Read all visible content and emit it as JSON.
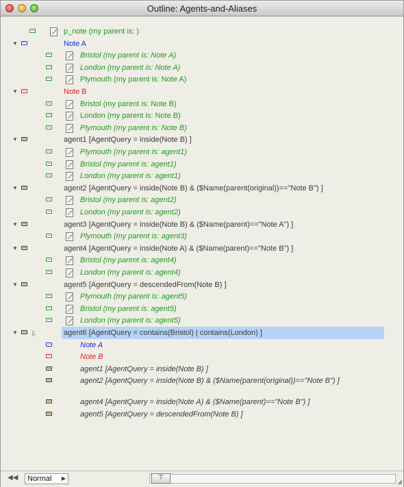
{
  "window": {
    "title": "Outline: Agents-and-Aliases"
  },
  "colors": {
    "green": "#1f9a1f",
    "blue": "#1f2bdc",
    "red": "#dc1f1f",
    "gray": "#3a3a3a",
    "selection": "#b5d3f5"
  },
  "rows": [
    {
      "indent": 0,
      "expand": false,
      "icon": "green",
      "doc": true,
      "alias": false,
      "label": "p_note  (my parent is: )",
      "color": "green",
      "italic": false
    },
    {
      "indent": 0,
      "expand": true,
      "icon": "blue",
      "doc": false,
      "alias": false,
      "label": "Note A",
      "color": "blue",
      "italic": false
    },
    {
      "indent": 1,
      "expand": false,
      "icon": "green",
      "doc": true,
      "alias": false,
      "label": "Bristol  (my parent is: Note A)",
      "color": "green",
      "italic": true
    },
    {
      "indent": 1,
      "expand": false,
      "icon": "green",
      "doc": true,
      "alias": false,
      "label": "London  (my parent is: Note A)",
      "color": "green",
      "italic": true
    },
    {
      "indent": 1,
      "expand": false,
      "icon": "green",
      "doc": true,
      "alias": false,
      "label": "Plymouth  (my parent is: Note A)",
      "color": "green",
      "italic": false
    },
    {
      "indent": 0,
      "expand": true,
      "icon": "red",
      "doc": false,
      "alias": false,
      "label": "Note B",
      "color": "red",
      "italic": false
    },
    {
      "indent": 1,
      "expand": false,
      "icon": "green",
      "doc": true,
      "alias": false,
      "label": "Bristol  (my parent is: Note B)",
      "color": "green",
      "italic": false
    },
    {
      "indent": 1,
      "expand": false,
      "icon": "green",
      "doc": true,
      "alias": false,
      "label": "London  (my parent is: Note B)",
      "color": "green",
      "italic": false
    },
    {
      "indent": 1,
      "expand": false,
      "icon": "green",
      "doc": true,
      "alias": false,
      "label": "Plymouth  (my parent is: Note B)",
      "color": "green",
      "italic": true
    },
    {
      "indent": 0,
      "expand": true,
      "icon": "gray",
      "doc": false,
      "alias": false,
      "label": "agent1  [AgentQuery = inside(Note B) ]",
      "color": "gray",
      "italic": false
    },
    {
      "indent": 1,
      "expand": false,
      "icon": "green",
      "doc": true,
      "alias": false,
      "label": "Plymouth  (my parent is: agent1)",
      "color": "green",
      "italic": true
    },
    {
      "indent": 1,
      "expand": false,
      "icon": "green",
      "doc": true,
      "alias": false,
      "label": "Bristol  (my parent is: agent1)",
      "color": "green",
      "italic": true
    },
    {
      "indent": 1,
      "expand": false,
      "icon": "green",
      "doc": true,
      "alias": false,
      "label": "London  (my parent is: agent1)",
      "color": "green",
      "italic": true
    },
    {
      "indent": 0,
      "expand": true,
      "icon": "gray",
      "doc": false,
      "alias": false,
      "label": "agent2  [AgentQuery = inside(Note B) & ($Name(parent(original))==\"Note B\") ]",
      "color": "gray",
      "italic": false
    },
    {
      "indent": 1,
      "expand": false,
      "icon": "green",
      "doc": true,
      "alias": false,
      "label": "Bristol  (my parent is: agent2)",
      "color": "green",
      "italic": true
    },
    {
      "indent": 1,
      "expand": false,
      "icon": "green",
      "doc": true,
      "alias": false,
      "label": "London  (my parent is: agent2)",
      "color": "green",
      "italic": true
    },
    {
      "indent": 0,
      "expand": true,
      "icon": "gray",
      "doc": false,
      "alias": false,
      "label": "agent3  [AgentQuery = inside(Note B) & ($Name(parent)==\"Note A\") ]",
      "color": "gray",
      "italic": false
    },
    {
      "indent": 1,
      "expand": false,
      "icon": "green",
      "doc": true,
      "alias": false,
      "label": "Plymouth  (my parent is: agent3)",
      "color": "green",
      "italic": true
    },
    {
      "indent": 0,
      "expand": true,
      "icon": "gray",
      "doc": false,
      "alias": false,
      "label": "agent4  [AgentQuery = inside(Note A) & ($Name(parent)==\"Note B\") ]",
      "color": "gray",
      "italic": false
    },
    {
      "indent": 1,
      "expand": false,
      "icon": "green",
      "doc": true,
      "alias": false,
      "label": "Bristol  (my parent is: agent4)",
      "color": "green",
      "italic": true
    },
    {
      "indent": 1,
      "expand": false,
      "icon": "green",
      "doc": true,
      "alias": false,
      "label": "London  (my parent is: agent4)",
      "color": "green",
      "italic": true
    },
    {
      "indent": 0,
      "expand": true,
      "icon": "gray",
      "doc": false,
      "alias": false,
      "label": "agent5  [AgentQuery = descendedFrom(Note B) ]",
      "color": "gray",
      "italic": false
    },
    {
      "indent": 1,
      "expand": false,
      "icon": "green",
      "doc": true,
      "alias": false,
      "label": "Plymouth  (my parent is: agent5)",
      "color": "green",
      "italic": true
    },
    {
      "indent": 1,
      "expand": false,
      "icon": "green",
      "doc": true,
      "alias": false,
      "label": "Bristol  (my parent is: agent5)",
      "color": "green",
      "italic": true
    },
    {
      "indent": 1,
      "expand": false,
      "icon": "green",
      "doc": true,
      "alias": false,
      "label": "London  (my parent is: agent5)",
      "color": "green",
      "italic": true
    },
    {
      "indent": 0,
      "expand": true,
      "icon": "gray",
      "doc": false,
      "alias": true,
      "label": "agent6  [AgentQuery = contains(Bristol) | contains(London) ]",
      "color": "gray",
      "italic": false,
      "selected": true
    },
    {
      "indent": 1,
      "expand": false,
      "icon": "blue",
      "doc": false,
      "alias": false,
      "label": "Note A",
      "color": "blue",
      "italic": true
    },
    {
      "indent": 1,
      "expand": false,
      "icon": "red",
      "doc": false,
      "alias": false,
      "label": "Note B",
      "color": "red",
      "italic": true
    },
    {
      "indent": 1,
      "expand": false,
      "icon": "gray",
      "doc": false,
      "alias": false,
      "label": "agent1  [AgentQuery = inside(Note B) ]",
      "color": "gray",
      "italic": true
    },
    {
      "indent": 1,
      "expand": false,
      "icon": "gray",
      "doc": false,
      "alias": false,
      "label": "agent2  [AgentQuery = inside(Note B) & ($Name(parent(original))==\"Note B\") ]",
      "color": "gray",
      "italic": true,
      "wrap": true
    },
    {
      "indent": 1,
      "expand": false,
      "icon": "gray",
      "doc": false,
      "alias": false,
      "label": "agent4  [AgentQuery = inside(Note A) & ($Name(parent)==\"Note B\") ]",
      "color": "gray",
      "italic": true
    },
    {
      "indent": 1,
      "expand": false,
      "icon": "gray",
      "doc": false,
      "alias": false,
      "label": "agent5  [AgentQuery = descendedFrom(Note B) ]",
      "color": "gray",
      "italic": true
    }
  ],
  "statusbar": {
    "view_mode": "Normal"
  }
}
